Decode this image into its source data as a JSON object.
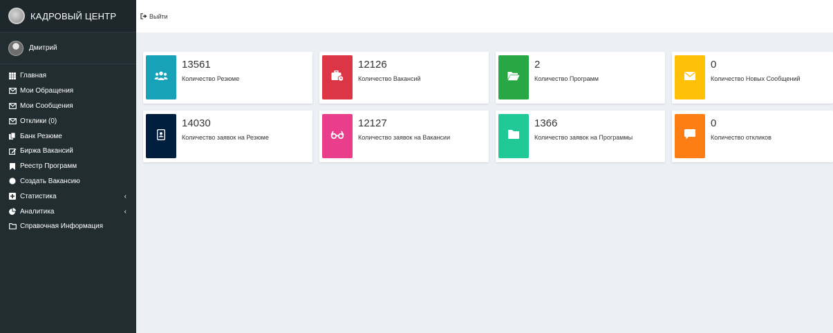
{
  "brand": {
    "title": "КАДРОВЫЙ ЦЕНТР"
  },
  "user": {
    "name": "Дмитрий"
  },
  "topbar": {
    "logout_label": "Выйти"
  },
  "sidebar": {
    "items": [
      {
        "label": "Главная",
        "icon": "grid-icon"
      },
      {
        "label": "Мои Обращения",
        "icon": "envelope-icon"
      },
      {
        "label": "Мои Сообщения",
        "icon": "envelope-icon"
      },
      {
        "label": "Отклики (0)",
        "icon": "envelope-icon"
      },
      {
        "label": "Банк Резюме",
        "icon": "copy-icon"
      },
      {
        "label": "Биржа Вакансий",
        "icon": "edit-icon"
      },
      {
        "label": "Реестр Программ",
        "icon": "bookmark-icon"
      },
      {
        "label": "Создать Вакансию",
        "icon": "circle-icon"
      },
      {
        "label": "Статистика",
        "icon": "plus-square-icon",
        "chevron": "‹"
      },
      {
        "label": "Аналитика",
        "icon": "pie-chart-icon",
        "chevron": "‹"
      },
      {
        "label": "Справочная Информация",
        "icon": "folder-icon"
      }
    ]
  },
  "cards": [
    {
      "value": "13561",
      "label": "Количество Резюме",
      "color": "#17a2b8",
      "icon": "users-icon"
    },
    {
      "value": "12126",
      "label": "Количество Вакансий",
      "color": "#dc3545",
      "icon": "briefcase-clock-icon"
    },
    {
      "value": "2",
      "label": "Количество Программ",
      "color": "#28a745",
      "icon": "folder-open-icon"
    },
    {
      "value": "0",
      "label": "Количество Новых Сообщений",
      "color": "#ffc107",
      "icon": "envelope-icon"
    },
    {
      "value": "14030",
      "label": "Количество заявок на Резюме",
      "color": "#001f3f",
      "icon": "id-badge-icon"
    },
    {
      "value": "12127",
      "label": "Количество заявок на Вакансии",
      "color": "#e83e8c",
      "icon": "glasses-icon"
    },
    {
      "value": "1366",
      "label": "Количество заявок на Программы",
      "color": "#20c997",
      "icon": "folder-icon"
    },
    {
      "value": "0",
      "label": "Количество откликов",
      "color": "#fd7e14",
      "icon": "comment-icon"
    }
  ]
}
